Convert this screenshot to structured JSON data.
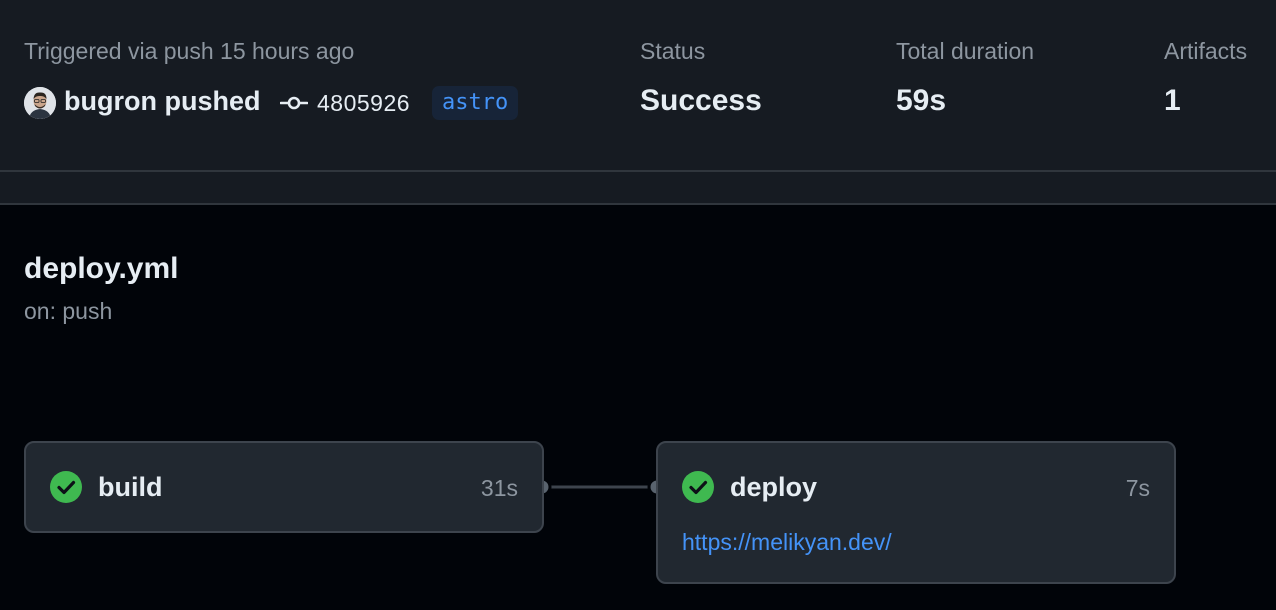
{
  "run": {
    "trigger_label": "Triggered via push 15 hours ago",
    "pusher": "bugron pushed",
    "commit_sha": "4805926",
    "branch": "astro"
  },
  "stats": {
    "status_label": "Status",
    "status_value": "Success",
    "duration_label": "Total duration",
    "duration_value": "59s",
    "artifacts_label": "Artifacts",
    "artifacts_value": "1"
  },
  "workflow": {
    "name": "deploy.yml",
    "trigger": "on: push"
  },
  "jobs": [
    {
      "name": "build",
      "duration": "31s",
      "status": "success"
    },
    {
      "name": "deploy",
      "duration": "7s",
      "status": "success",
      "url": "https://melikyan.dev/"
    }
  ],
  "icons": {
    "avatar": "user-avatar",
    "commit": "git-commit-icon",
    "job_status": "check-circle-icon"
  },
  "colors": {
    "background": "#010409",
    "panel": "#161b22",
    "job_box": "#212830",
    "success": "#3fb950",
    "link": "#4493f8",
    "muted_text": "#8d96a0"
  }
}
